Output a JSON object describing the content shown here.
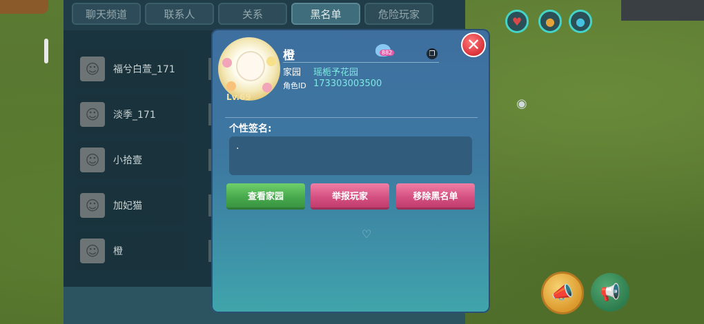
{
  "tabs": [
    {
      "label": "聊天频道"
    },
    {
      "label": "联系人"
    },
    {
      "label": "关系"
    },
    {
      "label": "黑名单"
    },
    {
      "label": "危险玩家"
    }
  ],
  "active_tab": "黑名单",
  "blacklist": [
    {
      "name": "福兮白萱_171"
    },
    {
      "name": "淡季_171"
    },
    {
      "name": "小拾壹"
    },
    {
      "name": "加妃猫"
    },
    {
      "name": "橙"
    }
  ],
  "profile": {
    "name": "橙",
    "level": "Lv.69",
    "heart_count": "882",
    "home_label": "家园",
    "home_value": "瑶栀予花园",
    "id_label": "角色ID",
    "id_value": "173303003500",
    "signature_label": "个性签名:",
    "signature_value": "."
  },
  "buttons": {
    "view_home": "查看家园",
    "report": "举报玩家",
    "remove_blacklist": "移除黑名单"
  },
  "colors": {
    "accent": "#45d4c8",
    "green_button": "#46a84c",
    "pink_button": "#d24f7f",
    "close_button": "#d9323a"
  }
}
